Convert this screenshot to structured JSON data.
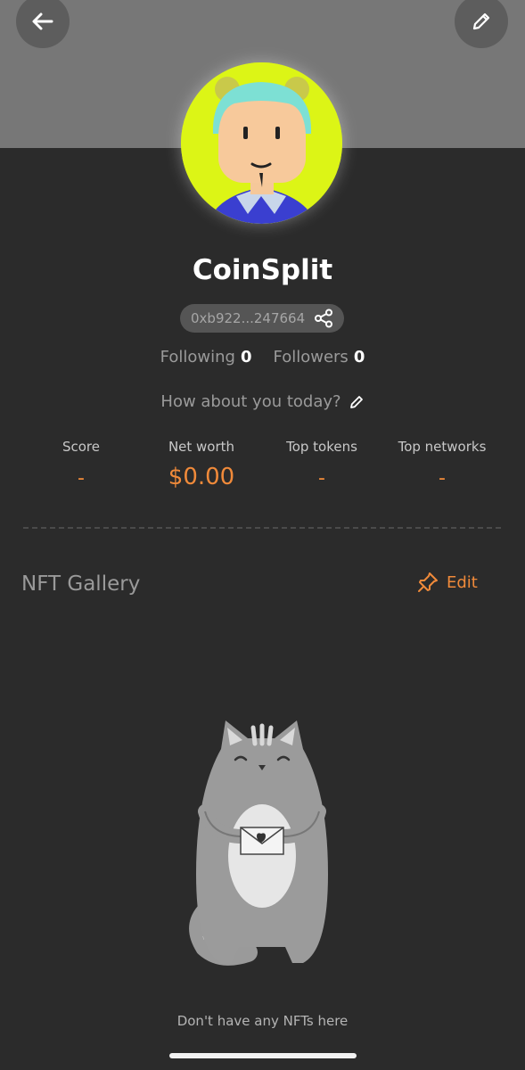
{
  "header": {
    "back_icon": "arrow-left-icon",
    "edit_icon": "pencil-icon"
  },
  "profile": {
    "name": "CoinSplit",
    "address": "0xb922...247664",
    "share_icon": "share-icon",
    "following_label": "Following",
    "following_count": "0",
    "followers_label": "Followers",
    "followers_count": "0",
    "status_placeholder": "How about you today?",
    "avatar_bg": "#dcf516"
  },
  "stats": [
    {
      "label": "Score",
      "value": "-"
    },
    {
      "label": "Net worth",
      "value": "$0.00"
    },
    {
      "label": "Top tokens",
      "value": "-"
    },
    {
      "label": "Top networks",
      "value": "-"
    }
  ],
  "nft_gallery": {
    "title": "NFT Gallery",
    "edit_label": "Edit",
    "edit_icon": "pin-icon",
    "empty_message": "Don't have any NFTs here"
  },
  "colors": {
    "accent": "#f08a3a",
    "background": "#2b2b2b",
    "banner": "#777777"
  }
}
